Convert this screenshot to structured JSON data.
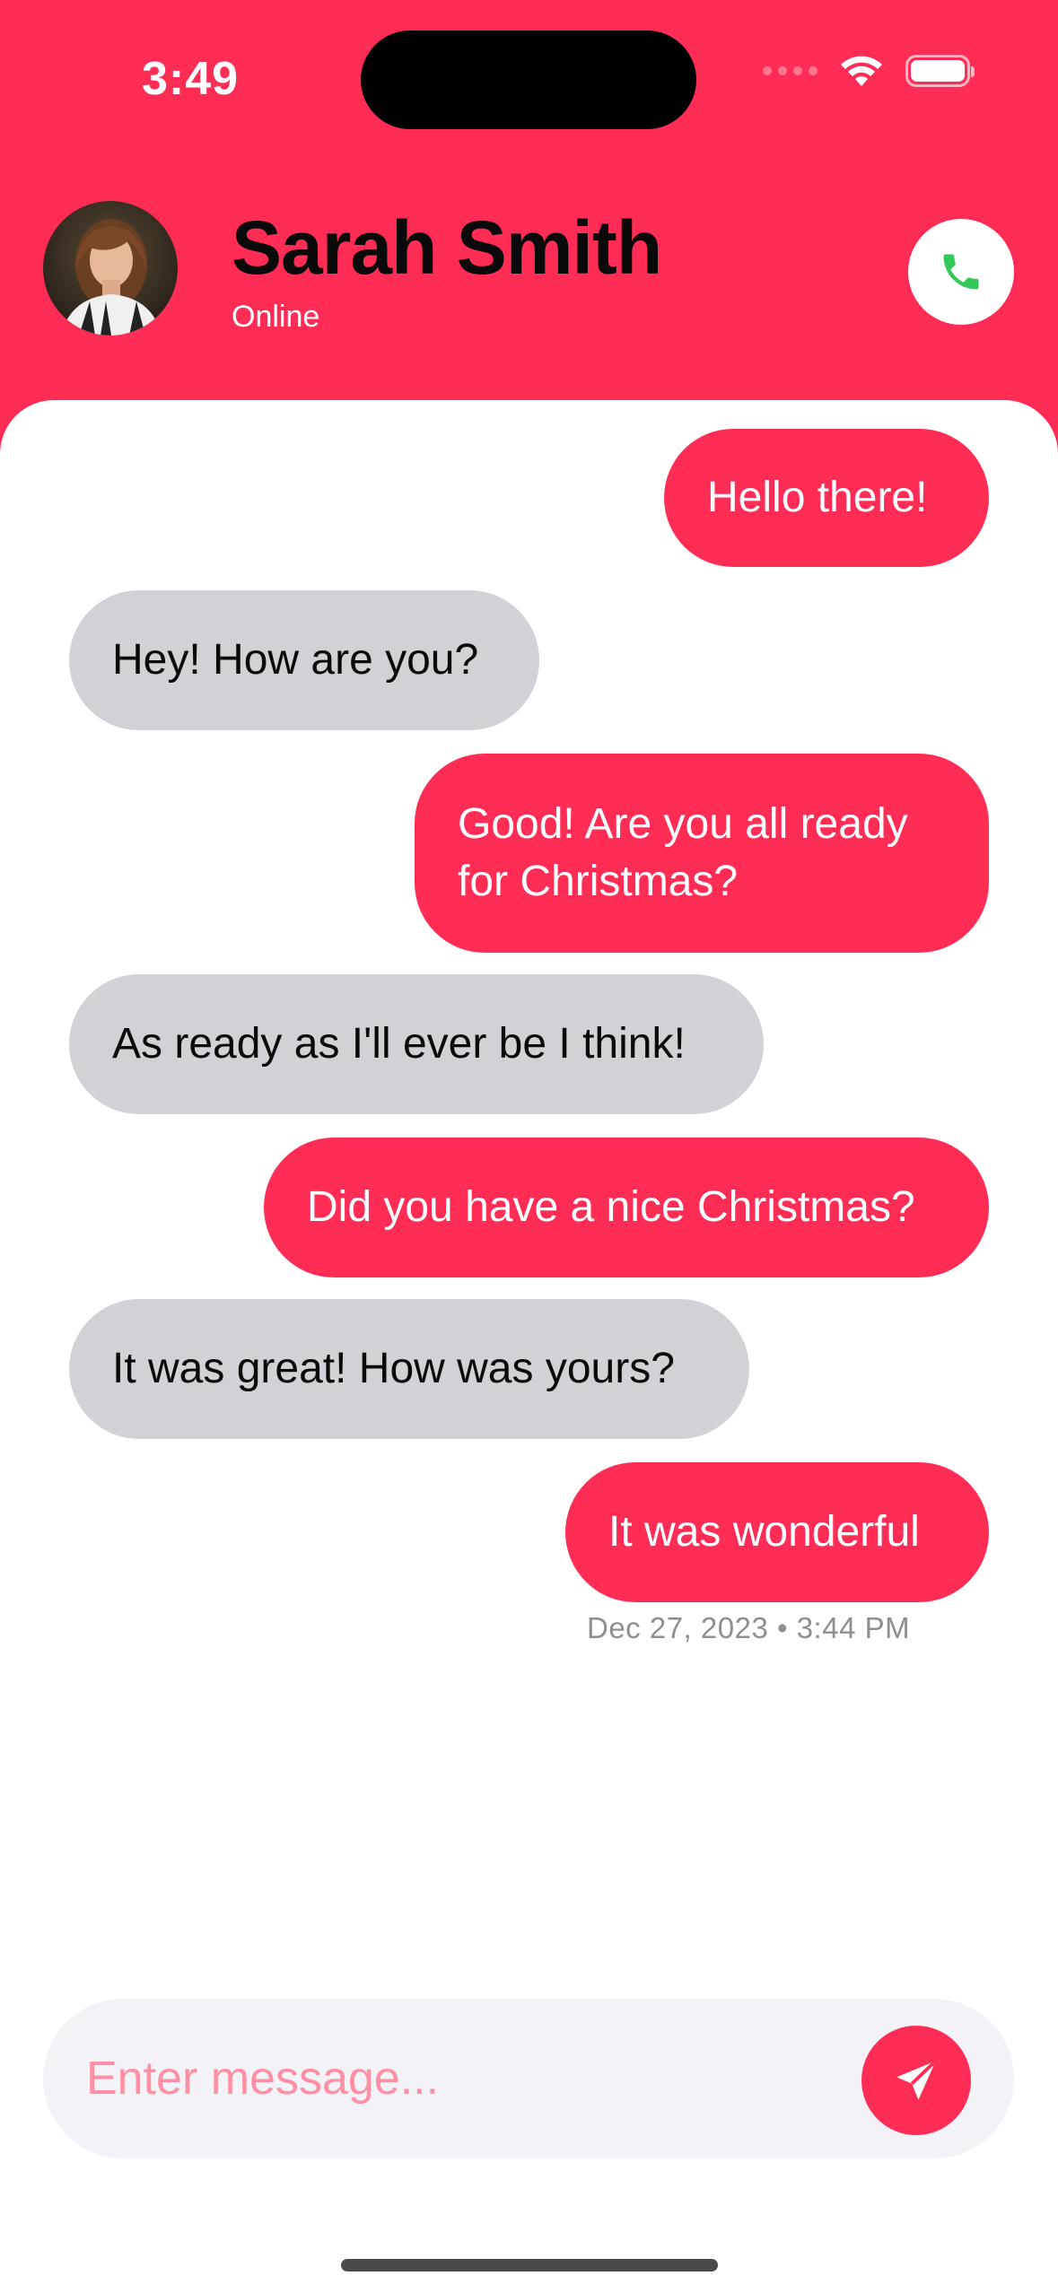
{
  "status_bar": {
    "time": "3:49"
  },
  "header": {
    "contact_name": "Sarah Smith",
    "contact_status": "Online",
    "call_icon": "phone-icon"
  },
  "messages": [
    {
      "direction": "sent",
      "text": "Hello there!"
    },
    {
      "direction": "received",
      "text": "Hey! How are you?"
    },
    {
      "direction": "sent",
      "text": "Good! Are you all ready for Christmas?"
    },
    {
      "direction": "received",
      "text": "As ready as I'll ever be I think!"
    },
    {
      "direction": "sent",
      "text": "Did you have a nice Christmas?"
    },
    {
      "direction": "received",
      "text": "It was great! How was yours?"
    },
    {
      "direction": "sent",
      "text": "It was wonderful"
    }
  ],
  "last_message_timestamp": "Dec 27, 2023 • 3:44 PM",
  "composer": {
    "placeholder": "Enter message...",
    "value": "",
    "send_icon": "paper-plane-icon"
  },
  "colors": {
    "accent": "#ff2d55",
    "received_bubble": "#d1d1d6",
    "call_icon": "#34c759",
    "composer_bg": "#f2f2f7"
  }
}
